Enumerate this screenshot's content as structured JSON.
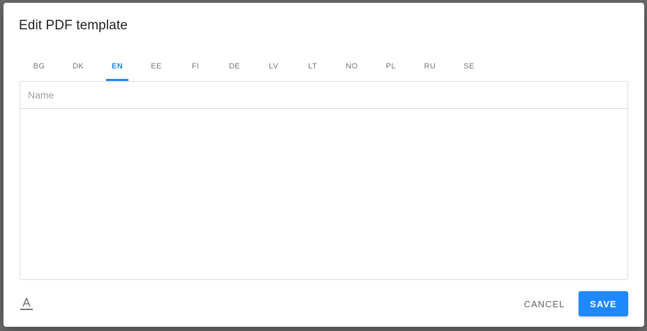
{
  "dialog": {
    "title": "Edit PDF template",
    "tabs": [
      {
        "label": "BG",
        "active": false
      },
      {
        "label": "DK",
        "active": false
      },
      {
        "label": "EN",
        "active": true
      },
      {
        "label": "EE",
        "active": false
      },
      {
        "label": "FI",
        "active": false
      },
      {
        "label": "DE",
        "active": false
      },
      {
        "label": "LV",
        "active": false
      },
      {
        "label": "LT",
        "active": false
      },
      {
        "label": "NO",
        "active": false
      },
      {
        "label": "PL",
        "active": false
      },
      {
        "label": "RU",
        "active": false
      },
      {
        "label": "SE",
        "active": false
      }
    ],
    "name_field": {
      "value": "",
      "placeholder": "Name"
    },
    "body_field": {
      "value": ""
    },
    "format_icon": "text-format-icon",
    "cancel_label": "CANCEL",
    "save_label": "SAVE"
  },
  "colors": {
    "accent": "#1e88e5",
    "save_button": "#1e88ff",
    "tab_inactive": "#757575",
    "backdrop": "#6b6b6b"
  }
}
